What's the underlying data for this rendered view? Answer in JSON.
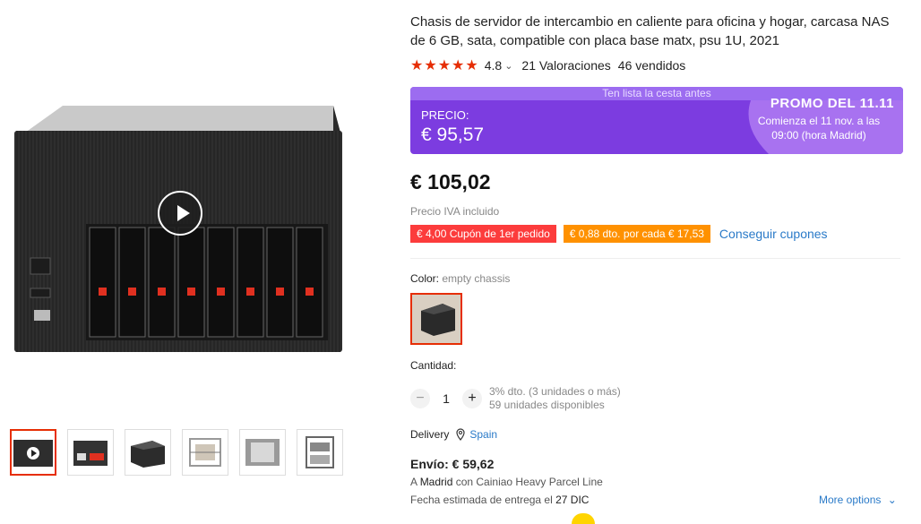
{
  "product": {
    "title": "Chasis de servidor de intercambio en caliente para oficina y hogar, carcasa NAS de 6 GB, sata, compatible con placa base matx, psu 1U, 2021",
    "rating_stars": "★★★★★",
    "rating_value": "4.8",
    "rating_chevron": "⌄",
    "rating_fraction": 0.96,
    "reviews": "21 Valoraciones",
    "sold": "46 vendidos"
  },
  "promo": {
    "banner": "Ten lista la cesta antes",
    "price_label": "PRECIO:",
    "price": "€ 95,57",
    "event": "PROMO DEL 11.11",
    "starts": "Comienza el 11 nov. a las 09:00 (hora Madrid)"
  },
  "price": {
    "value": "€ 105,02",
    "vat_note": "Precio IVA incluido"
  },
  "coupons": {
    "first_order": "€ 4,00 Cupón de 1er pedido",
    "discount": "€ 0,88 dto. por cada € 17,53",
    "get_link": "Conseguir cupones"
  },
  "color": {
    "label": "Color: ",
    "value": "empty chassis"
  },
  "quantity": {
    "label": "Cantidad:",
    "minus": "−",
    "plus": "+",
    "value": "1",
    "discount_note": "3% dto. (3 unidades o más)",
    "available": "59 unidades disponibles"
  },
  "delivery": {
    "label": "Delivery",
    "country": "Spain",
    "shipping_label": "Envío: € 59,62",
    "via_prefix": "A ",
    "via_city": "Madrid",
    "via_suffix": " con Cainiao Heavy Parcel Line",
    "date_prefix": "Fecha estimada de entrega el ",
    "date": "27 DIC",
    "more_options": "More options"
  },
  "colors": {
    "accent_red": "#e62e04",
    "promo_purple": "#7c3ce0",
    "coupon_red": "#fc3c3c",
    "coupon_orange": "#ff9100",
    "link_blue": "#2a7ac8"
  }
}
